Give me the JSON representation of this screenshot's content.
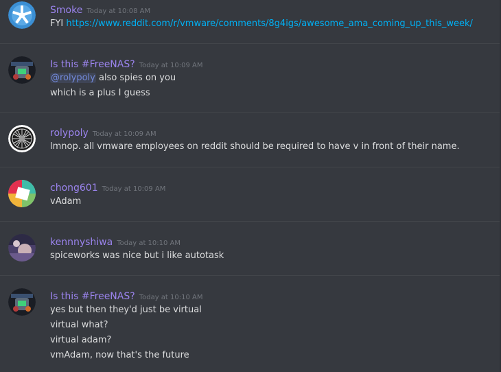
{
  "messages": [
    {
      "username": "Smoke",
      "timestamp": "Today at 10:08 AM",
      "avatar": "smoke-avatar",
      "lines": [
        {
          "prefix": "FYI ",
          "link": "https://www.reddit.com/r/vmware/comments/8g4igs/awesome_ama_coming_up_this_week/"
        }
      ]
    },
    {
      "username": "Is this #FreeNAS?",
      "timestamp": "Today at 10:09 AM",
      "avatar": "metroid-avatar",
      "lines": [
        {
          "mention": "@rolypoly",
          "text": " also spies on you"
        },
        {
          "text": "which is a plus I guess"
        }
      ]
    },
    {
      "username": "rolypoly",
      "timestamp": "Today at 10:09 AM",
      "avatar": "wheel-avatar",
      "lines": [
        {
          "text": "lmnop. all vmware employees on reddit should be required to have v in front of their name."
        }
      ]
    },
    {
      "username": "chong601",
      "timestamp": "Today at 10:09 AM",
      "avatar": "colorful-avatar",
      "lines": [
        {
          "text": "vAdam"
        }
      ]
    },
    {
      "username": "kennnyshiwa",
      "timestamp": "Today at 10:10 AM",
      "avatar": "photo-avatar",
      "lines": [
        {
          "text": "spiceworks was nice but i like autotask"
        }
      ]
    },
    {
      "username": "Is this #FreeNAS?",
      "timestamp": "Today at 10:10 AM",
      "avatar": "metroid-avatar",
      "lines": [
        {
          "text": "yes but then they'd just be virtual"
        },
        {
          "text": "virtual what?"
        },
        {
          "text": "virtual adam?"
        },
        {
          "text": "vmAdam, now that's the future"
        }
      ]
    }
  ],
  "colors": {
    "background": "#36393f",
    "username": "#9b84ee",
    "timestamp": "#72767d",
    "text": "#dcddde",
    "link": "#00b0f4",
    "mention": "#7289da",
    "divider": "#42454a"
  }
}
